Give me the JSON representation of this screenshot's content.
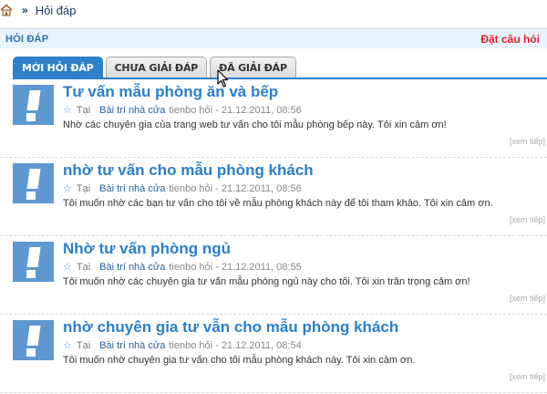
{
  "breadcrumb": {
    "sep": "»",
    "current": "Hỏi đáp"
  },
  "header": {
    "title": "HỎI ĐÁP",
    "ask_label": "Đặt câu hỏi"
  },
  "tabs": [
    {
      "label": "MỚI HỎI ĐÁP",
      "active": true
    },
    {
      "label": "CHƯA GIẢI ĐÁP",
      "active": false
    },
    {
      "label": "ĐÃ GIẢI ĐÁP",
      "active": false
    }
  ],
  "questions": [
    {
      "title": "Tư vấn mẫu phòng ăn và bếp",
      "location_label": "Tại",
      "category": "Bài trí nhà cửa",
      "info": "tienbo hỏi - 21.12.2011, 08:56",
      "desc": "Nhờ các chuyên gia của trang web tư vấn cho tôi mẫu phòng bếp này. Tôi xin cảm ơn!",
      "more": "[xem tiếp]"
    },
    {
      "title": "nhờ tư vấn cho mẫu phòng khách",
      "location_label": "Tại",
      "category": "Bài trí nhà cửa",
      "info": "tienbo hỏi - 21.12.2011, 08:56",
      "desc": "Tôi muốn nhờ các bạn tư vấn cho tôi về mẫu phòng khách này để tôi tham khảo. Tôi xin cảm ơn.",
      "more": "[xem tiếp]"
    },
    {
      "title": "Nhờ tư vấn phòng ngủ",
      "location_label": "Tại",
      "category": "Bài trí nhà cửa",
      "info": "tienbo hỏi - 21.12.2011, 08:55",
      "desc": "Tôi muốn nhờ các chuyên gia tư vấn mẫu phòng ngủ này cho tôi. Tôi xin trân trọng cảm ơn!",
      "more": "[xem tiếp]"
    },
    {
      "title": "nhờ chuyên gia tư vẫn cho mẫu phòng khách",
      "location_label": "Tại",
      "category": "Bài trí nhà cửa",
      "info": "tienbo hỏi - 21.12.2011, 08:54",
      "desc": "Tôi muốn nhờ chuyên gia tư vấn cho tôi mẫu phòng khách này. Tôi xin cảm ơn.",
      "more": "[xem tiếp]"
    }
  ],
  "colors": {
    "accent": "#2f80c8",
    "title": "#2a7fc9",
    "ask": "#d9262c",
    "header_bg": "#e8f2fb"
  },
  "icons": {
    "home": "home-icon",
    "star": "star-icon",
    "avatar": "question-avatar-icon",
    "cursor": "mouse-cursor-icon"
  }
}
